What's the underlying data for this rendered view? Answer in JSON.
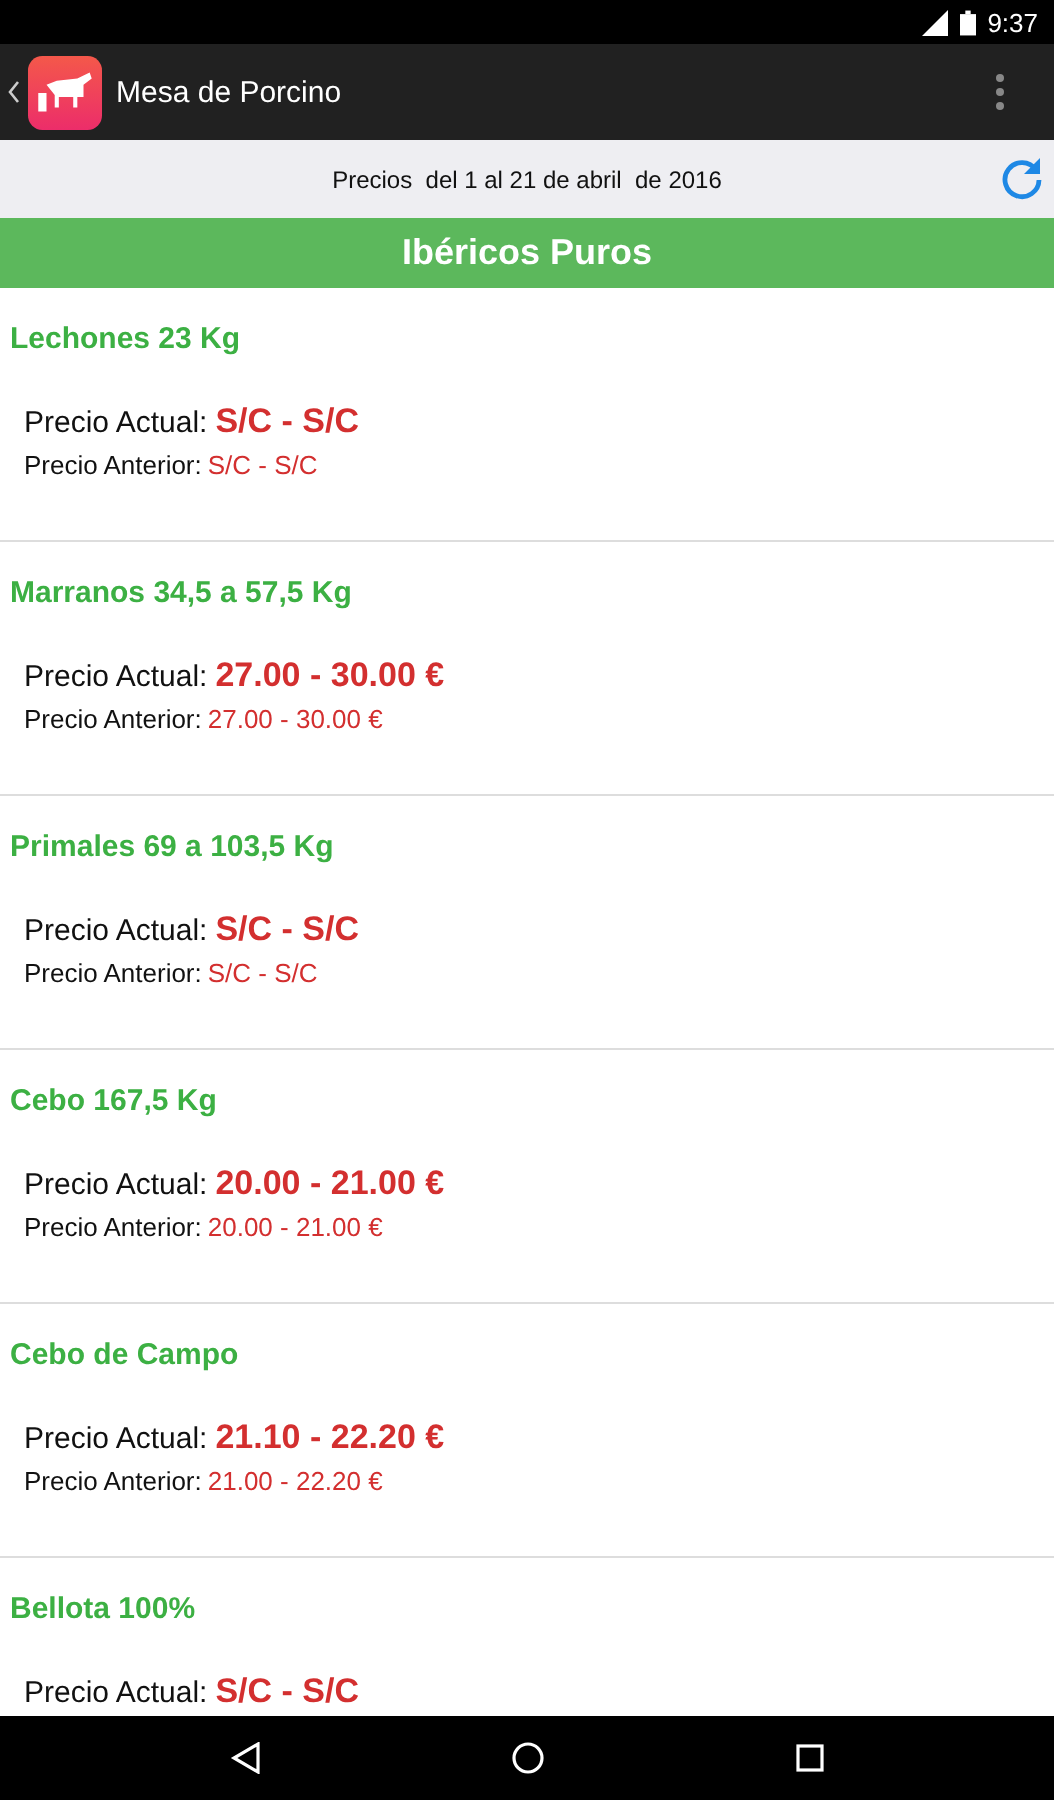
{
  "status_bar": {
    "time": "9:37"
  },
  "app_bar": {
    "title": "Mesa de Porcino"
  },
  "date_strip": {
    "text": "Precios  del 1 al 21 de abril  de 2016"
  },
  "section": {
    "title": "Ibéricos Puros"
  },
  "items": [
    {
      "title": "Lechones 23 Kg",
      "current_label": "Precio Actual:",
      "current": "S/C - S/C",
      "previous_label": "Precio Anterior:",
      "previous": "S/C - S/C"
    },
    {
      "title": "Marranos 34,5 a 57,5 Kg",
      "current_label": "Precio Actual:",
      "current": "27.00 - 30.00 €",
      "previous_label": "Precio Anterior:",
      "previous": "27.00 - 30.00 €"
    },
    {
      "title": "Primales 69 a 103,5 Kg",
      "current_label": "Precio Actual:",
      "current": "S/C - S/C",
      "previous_label": "Precio Anterior:",
      "previous": "S/C - S/C"
    },
    {
      "title": "Cebo 167,5 Kg",
      "current_label": "Precio Actual:",
      "current": "20.00 - 21.00 €",
      "previous_label": "Precio Anterior:",
      "previous": "20.00 - 21.00 €"
    },
    {
      "title": "Cebo de Campo",
      "current_label": "Precio Actual:",
      "current": "21.10 - 22.20 €",
      "previous_label": "Precio Anterior:",
      "previous": "21.00 - 22.20 €"
    },
    {
      "title": "Bellota 100%",
      "current_label": "Precio Actual:",
      "current": "S/C - S/C"
    }
  ]
}
